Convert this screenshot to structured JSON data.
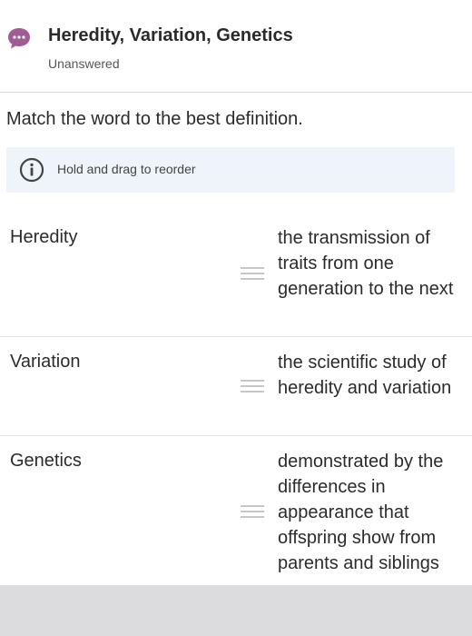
{
  "header": {
    "icon": "speech-bubble-ellipsis-icon",
    "icon_color": "#a05c93",
    "title": "Heredity, Variation, Genetics",
    "status": "Unanswered"
  },
  "question": {
    "prompt": "Match the word to the best definition."
  },
  "info": {
    "icon": "info-circle-icon",
    "text": "Hold and drag to reorder",
    "background": "#eef4f9"
  },
  "pairs": [
    {
      "term": "Heredity",
      "definition": "the transmission of traits from one generation to the next"
    },
    {
      "term": "Variation",
      "definition": "the scientific study of heredity and variation"
    },
    {
      "term": "Genetics",
      "definition": "demonstrated by the differences in appearance that offspring show from parents and siblings"
    }
  ],
  "colors": {
    "footer": "#dcdcdf",
    "divider": "#d6d6d6",
    "handle": "#c7c7c7"
  }
}
